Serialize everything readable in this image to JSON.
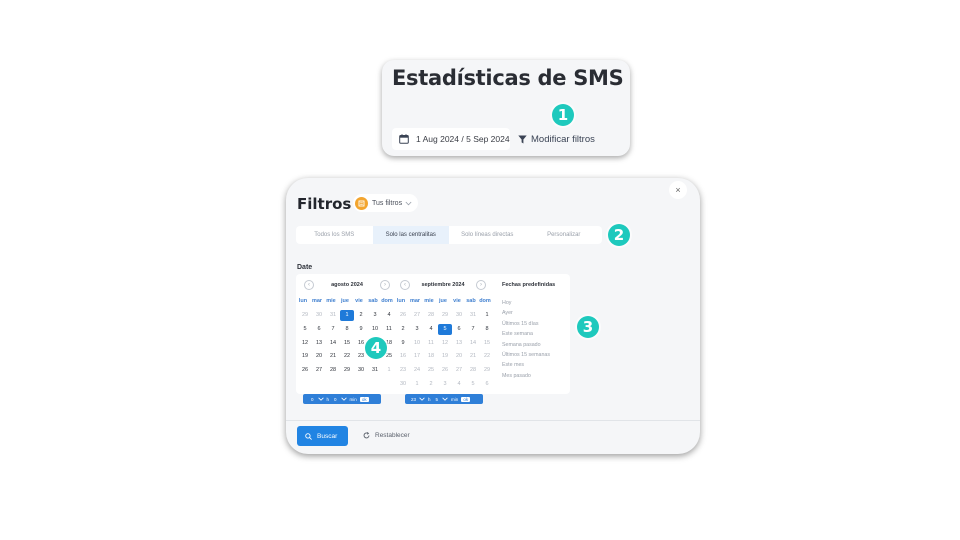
{
  "header": {
    "title": "Estadísticas de SMS",
    "date_range": "1 Aug 2024 / 5 Sep 2024",
    "modify_label": "Modificar filtros"
  },
  "markers": [
    "1",
    "2",
    "3",
    "4"
  ],
  "filters": {
    "title": "Filtros",
    "saved_filters_label": "Tus filtros",
    "close_symbol": "×",
    "tabs": [
      {
        "label": "Todos los SMS",
        "active": false
      },
      {
        "label": "Solo las centralitas",
        "active": true
      },
      {
        "label": "Solo líneas directas",
        "active": false
      },
      {
        "label": "Personalizar",
        "active": false
      }
    ],
    "date_label": "Date",
    "weekdays": [
      "lun",
      "mar",
      "mie",
      "jue",
      "vie",
      "sab",
      "dom"
    ],
    "calendars": [
      {
        "month": "agosto 2024",
        "weeks": [
          [
            {
              "d": "29",
              "m": true
            },
            {
              "d": "30",
              "m": true
            },
            {
              "d": "31",
              "m": true
            },
            {
              "d": "1",
              "sel": true
            },
            {
              "d": "2"
            },
            {
              "d": "3"
            },
            {
              "d": "4"
            }
          ],
          [
            {
              "d": "5"
            },
            {
              "d": "6"
            },
            {
              "d": "7"
            },
            {
              "d": "8"
            },
            {
              "d": "9"
            },
            {
              "d": "10"
            },
            {
              "d": "11"
            }
          ],
          [
            {
              "d": "12"
            },
            {
              "d": "13"
            },
            {
              "d": "14"
            },
            {
              "d": "15"
            },
            {
              "d": "16"
            },
            {
              "d": "17"
            },
            {
              "d": "18"
            }
          ],
          [
            {
              "d": "19"
            },
            {
              "d": "20"
            },
            {
              "d": "21"
            },
            {
              "d": "22"
            },
            {
              "d": "23"
            },
            {
              "d": "24"
            },
            {
              "d": "25"
            }
          ],
          [
            {
              "d": "26"
            },
            {
              "d": "27"
            },
            {
              "d": "28"
            },
            {
              "d": "29"
            },
            {
              "d": "30"
            },
            {
              "d": "31"
            },
            {
              "d": "1",
              "m": true
            }
          ]
        ],
        "time": {
          "hour": "0",
          "h_label": "h",
          "minute": "0",
          "min_label": "min",
          "ok_label": "ok"
        }
      },
      {
        "month": "septiembre 2024",
        "weeks": [
          [
            {
              "d": "26",
              "m": true
            },
            {
              "d": "27",
              "m": true
            },
            {
              "d": "28",
              "m": true
            },
            {
              "d": "29",
              "m": true
            },
            {
              "d": "30",
              "m": true
            },
            {
              "d": "31",
              "m": true
            },
            {
              "d": "1"
            }
          ],
          [
            {
              "d": "2"
            },
            {
              "d": "3"
            },
            {
              "d": "4"
            },
            {
              "d": "5",
              "sel": true
            },
            {
              "d": "6"
            },
            {
              "d": "7"
            },
            {
              "d": "8"
            }
          ],
          [
            {
              "d": "9"
            },
            {
              "d": "10",
              "m": true
            },
            {
              "d": "11",
              "m": true
            },
            {
              "d": "12",
              "m": true
            },
            {
              "d": "13",
              "m": true
            },
            {
              "d": "14",
              "m": true
            },
            {
              "d": "15",
              "m": true
            }
          ],
          [
            {
              "d": "16",
              "m": true
            },
            {
              "d": "17",
              "m": true
            },
            {
              "d": "18",
              "m": true
            },
            {
              "d": "19",
              "m": true
            },
            {
              "d": "20",
              "m": true
            },
            {
              "d": "21",
              "m": true
            },
            {
              "d": "22",
              "m": true
            }
          ],
          [
            {
              "d": "23",
              "m": true
            },
            {
              "d": "24",
              "m": true
            },
            {
              "d": "25",
              "m": true
            },
            {
              "d": "26",
              "m": true
            },
            {
              "d": "27",
              "m": true
            },
            {
              "d": "28",
              "m": true
            },
            {
              "d": "29",
              "m": true
            }
          ],
          [
            {
              "d": "30",
              "m": true
            },
            {
              "d": "1",
              "m": true
            },
            {
              "d": "2",
              "m": true
            },
            {
              "d": "3",
              "m": true
            },
            {
              "d": "4",
              "m": true
            },
            {
              "d": "5",
              "m": true
            },
            {
              "d": "6",
              "m": true
            }
          ]
        ],
        "time": {
          "hour": "23",
          "h_label": "h",
          "minute": "5",
          "min_label": "min",
          "ok_label": "ok"
        }
      }
    ],
    "predefined_title": "Fechas predefinidas",
    "predefined": [
      "Hoy",
      "Ayer",
      "Últimos 15 días",
      "Este semana",
      "Semana pasado",
      "Últimos 15 semanas",
      "Este mes",
      "Mes pasado"
    ],
    "search_label": "Buscar",
    "reset_label": "Restablecer"
  },
  "colors": {
    "accent": "#2184e3",
    "marker": "#1ec9bd",
    "saved_filters_icon": "#f3a52f"
  }
}
